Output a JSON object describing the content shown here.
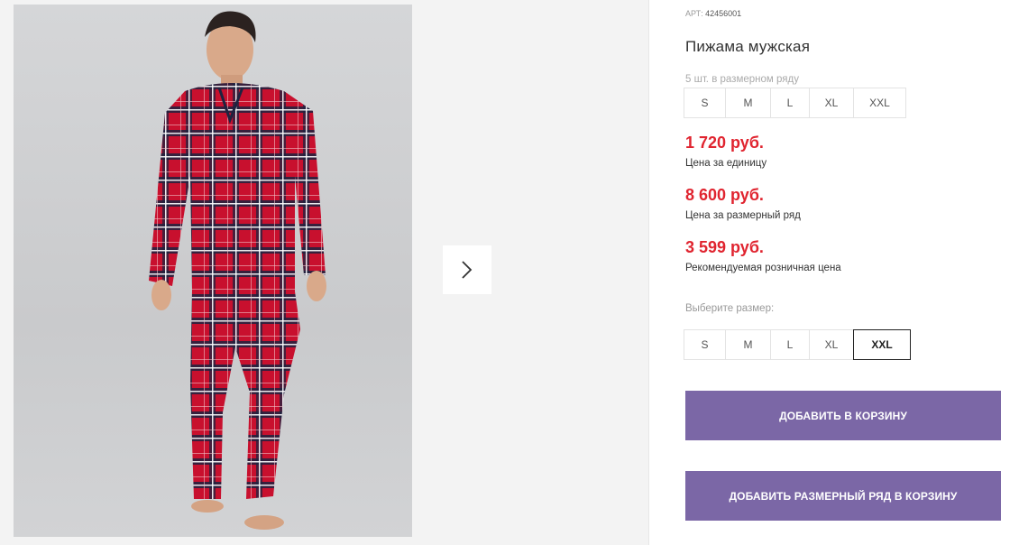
{
  "gallery": {
    "photo_alt": "Пижама мужская",
    "next_icon": "chevron-right-icon"
  },
  "product": {
    "art_label": "АРТ:",
    "art_number": "42456001",
    "title": "Пижама мужская",
    "range_label": "5 шт. в размерном ряду",
    "range_sizes": [
      "S",
      "M",
      "L",
      "XL",
      "XXL"
    ],
    "unit_price": "1 720 руб.",
    "unit_price_note": "Цена за единицу",
    "range_price": "8 600 руб.",
    "range_price_note": "Цена за размерный ряд",
    "retail_price": "3 599 руб.",
    "retail_price_note": "Рекомендуемая розничная цена",
    "choose_size_label": "Выберите размер:",
    "size_options": [
      "S",
      "M",
      "L",
      "XL",
      "XXL"
    ],
    "selected_size": "XXL",
    "add_to_cart": "Добавить в корзину",
    "add_range_to_cart": "Добавить размерный ряд в корзину"
  },
  "colors": {
    "price": "#e0242f",
    "button": "#7b67a6",
    "gallery_bg": "#f3f3f3"
  }
}
